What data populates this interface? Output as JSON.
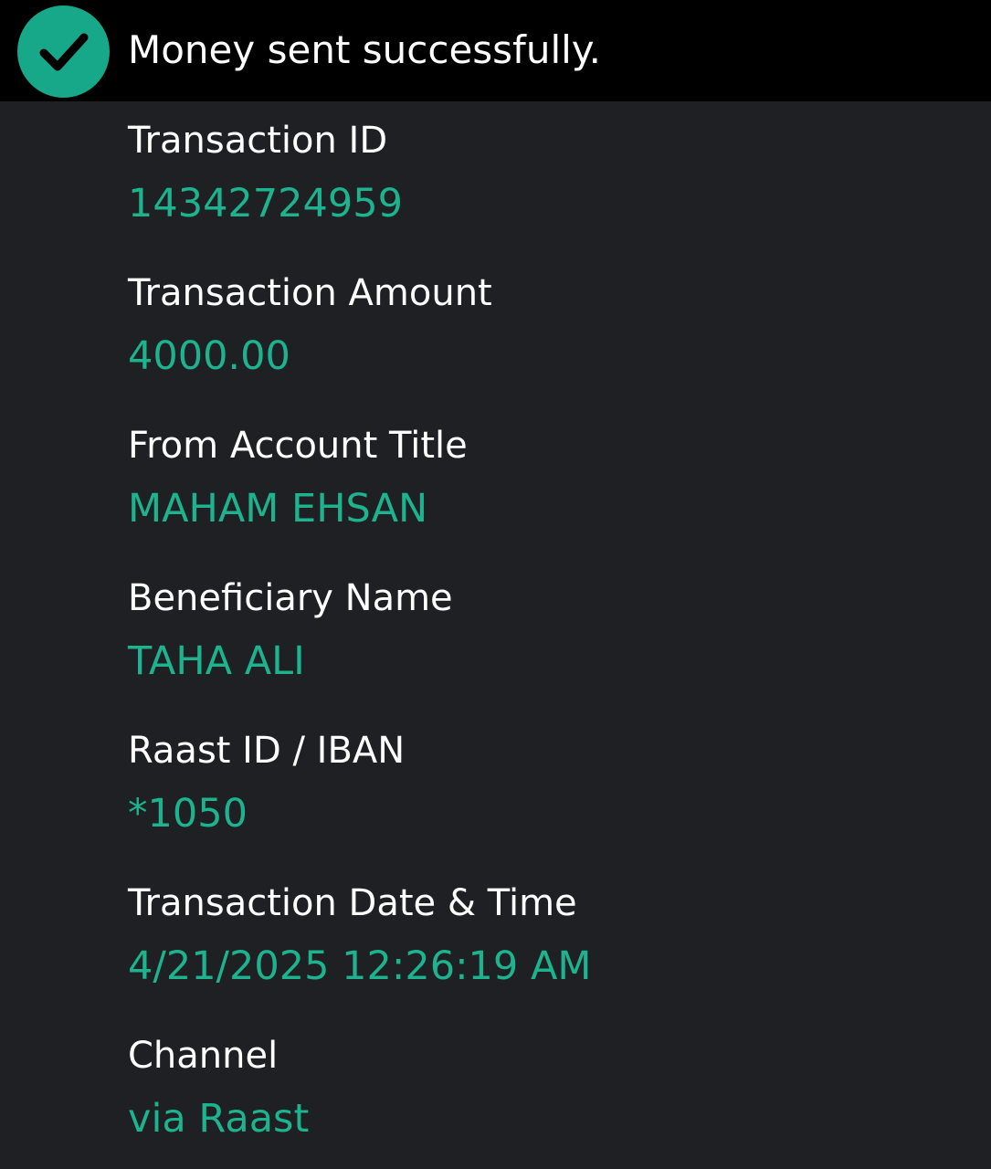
{
  "header": {
    "title": "Money sent successfully.",
    "icon": "check-circle-icon",
    "icon_color": "#17a88a"
  },
  "details": [
    {
      "label": "Transaction ID",
      "value": "14342724959"
    },
    {
      "label": "Transaction Amount",
      "value": "4000.00"
    },
    {
      "label": "From Account Title",
      "value": "MAHAM EHSAN"
    },
    {
      "label": "Beneficiary Name",
      "value": "TAHA ALI"
    },
    {
      "label": "Raast ID / IBAN",
      "value": "*1050"
    },
    {
      "label": "Transaction Date & Time",
      "value": "4/21/2025 12:26:19 AM"
    },
    {
      "label": "Channel",
      "value": "via Raast"
    }
  ],
  "colors": {
    "background": "#1f2023",
    "header_background": "#000000",
    "label": "#ffffff",
    "value": "#1db38f"
  }
}
